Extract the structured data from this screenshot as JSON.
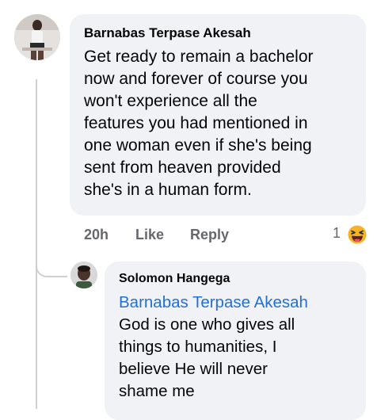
{
  "comment": {
    "author": "Barnabas Terpase Akesah",
    "text_lines": [
      "Get ready to remain a bachelor",
      "now and forever of course you",
      "won't experience all the",
      "features you had mentioned in",
      "one woman even if she's being",
      "sent from heaven provided",
      "she's in a human form."
    ],
    "time": "20h",
    "like_label": "Like",
    "reply_label": "Reply",
    "reaction_count": "1",
    "reaction_icon": "haha-emoji-icon"
  },
  "reply": {
    "author": "Solomon Hangega",
    "mention": "Barnabas Terpase Akesah",
    "text_lines": [
      "God is one who gives all",
      "things to humanities, I",
      "believe He will never",
      "shame me"
    ]
  },
  "colors": {
    "bubble": "#f0f2f5",
    "mention": "#216fdb",
    "meta": "#65676b",
    "thread_line": "#ced0d4"
  }
}
